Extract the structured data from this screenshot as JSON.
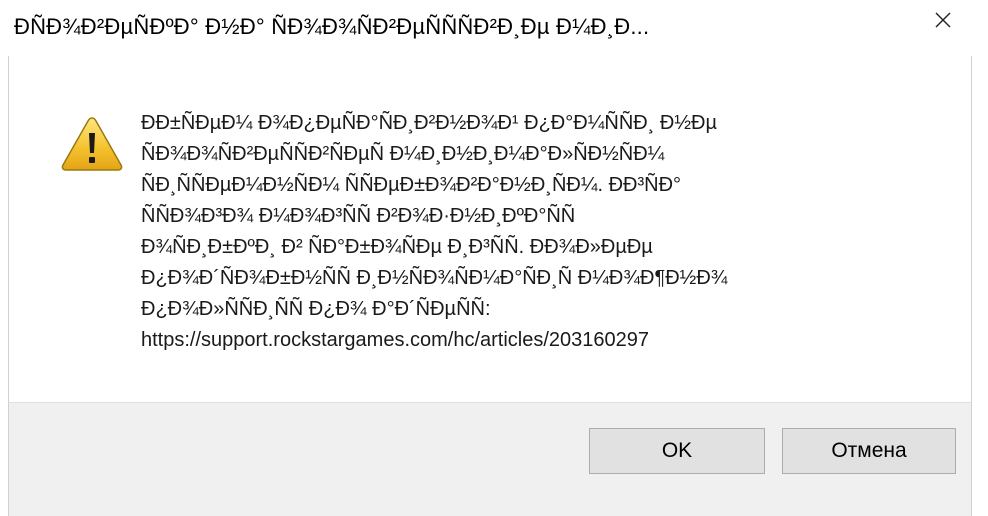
{
  "window": {
    "title": "ÐÑÐ¾Ð²ÐµÑÐºÐ° Ð½Ð° ÑÐ¾Ð¾ÑÐ²ÐµÑÑÑÐ²Ð¸Ðµ Ð¼Ð¸Ð...",
    "close_symbol": "✕"
  },
  "dialog": {
    "icon": "warning-icon",
    "message_lines": [
      "ÐÐ±ÑÐµÐ¼ Ð¾Ð¿ÐµÑÐ°ÑÐ¸Ð²Ð½Ð¾Ð¹ Ð¿Ð°Ð¼ÑÑÐ¸ Ð½Ðµ",
      "ÑÐ¾Ð¾ÑÐ²ÐµÑÑÐ²ÑÐµÑ Ð¼Ð¸Ð½Ð¸Ð¼Ð°Ð»ÑÐ½ÑÐ¼",
      "ÑÐ¸ÑÑÐµÐ¼Ð½ÑÐ¼ ÑÑÐµÐ±Ð¾Ð²Ð°Ð½Ð¸ÑÐ¼. ÐÐ³ÑÐ°",
      "ÑÑÐ¾Ð³Ð¾ Ð¼Ð¾Ð³ÑÑ Ð²Ð¾Ð·Ð½Ð¸ÐºÐ°ÑÑ",
      "Ð¾ÑÐ¸Ð±ÐºÐ¸ Ð² ÑÐ°Ð±Ð¾ÑÐµ Ð¸Ð³ÑÑ. ÐÐ¾Ð»ÐµÐµ",
      "Ð¿Ð¾Ð´ÑÐ¾Ð±Ð½ÑÑ Ð¸Ð½ÑÐ¾ÑÐ¼Ð°ÑÐ¸Ñ Ð¼Ð¾Ð¶Ð½Ð¾",
      "Ð¿Ð¾Ð»ÑÑÐ¸ÑÑ Ð¿Ð¾ Ð°Ð´ÑÐµÑÑ:",
      "https://support.rockstargames.com/hc/articles/203160297"
    ]
  },
  "buttons": {
    "ok_label": "OK",
    "cancel_label": "Отмена"
  },
  "colors": {
    "warning_yellow": "#f5c431",
    "warning_outline": "#9a7a10",
    "footer_bg": "#f0f0f0",
    "button_bg": "#e1e1e1",
    "button_border": "#adadad"
  }
}
